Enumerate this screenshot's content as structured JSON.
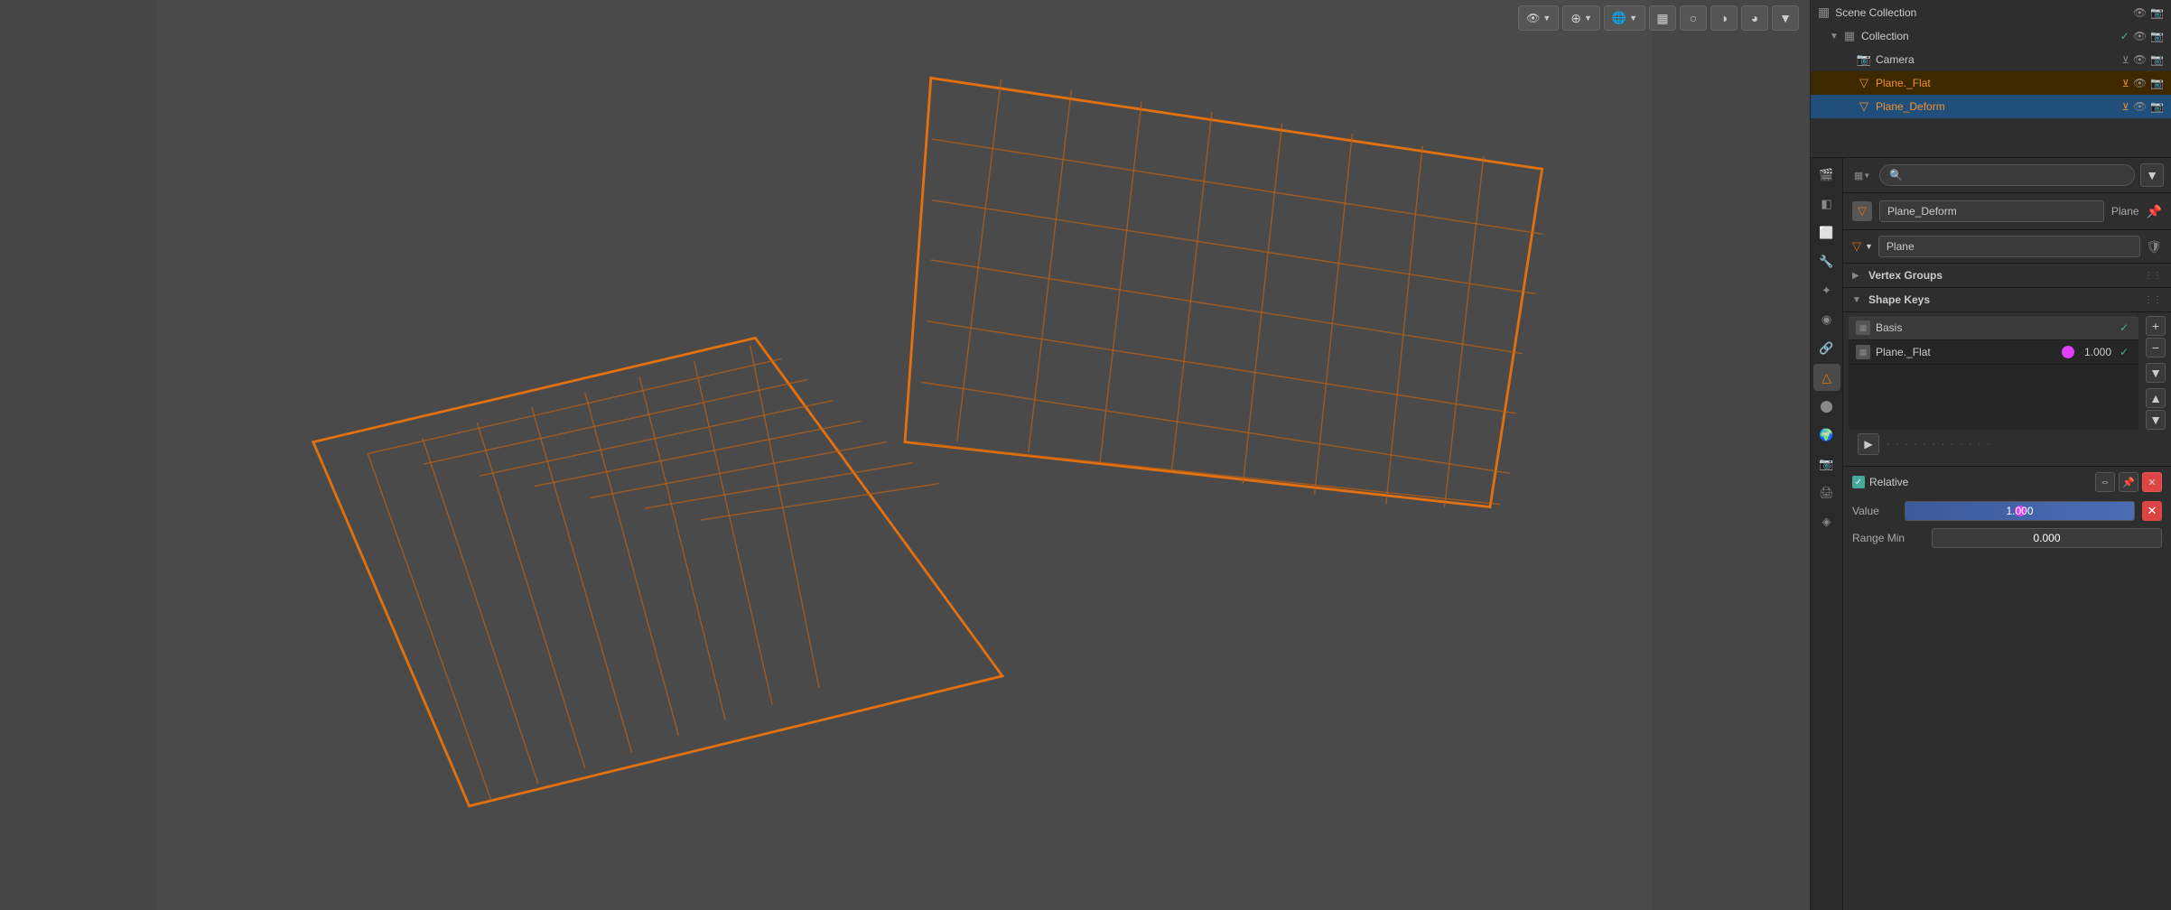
{
  "viewport": {
    "background_color": "#464646"
  },
  "toolbar": {
    "buttons": [
      {
        "id": "viewport-shading-icon",
        "label": "👁",
        "dropdown": true
      },
      {
        "id": "overlay-icon",
        "label": "⊕",
        "dropdown": true
      },
      {
        "id": "gizmo-icon",
        "label": "🌐",
        "dropdown": true
      },
      {
        "id": "object-mode-icon",
        "label": "▦"
      },
      {
        "id": "sphere-icon",
        "label": "○"
      },
      {
        "id": "material-icon",
        "label": "◑"
      },
      {
        "id": "rendered-icon",
        "label": "◕"
      },
      {
        "id": "dropdown-icon",
        "label": "▼"
      }
    ]
  },
  "outliner": {
    "header_title": "Scene Collection",
    "scene_collection_label": "Scene Collection",
    "collection_label": "Collection",
    "items": [
      {
        "id": "camera",
        "label": "Camera",
        "icon": "📷",
        "indent": 2,
        "selected": false
      },
      {
        "id": "plane-flat",
        "label": "Plane._Flat",
        "icon": "▽",
        "indent": 2,
        "selected": true,
        "highlight": "orange"
      },
      {
        "id": "plane-deform",
        "label": "Plane_Deform",
        "icon": "▽",
        "indent": 2,
        "selected": true,
        "highlight": "blue"
      }
    ]
  },
  "properties": {
    "search_placeholder": "🔍",
    "object_name": "Plane_Deform",
    "object_icon": "▽",
    "object_type": "Plane",
    "mesh_name": "Plane",
    "sections": {
      "vertex_groups": {
        "label": "Vertex Groups",
        "collapsed": true
      },
      "shape_keys": {
        "label": "Shape Keys",
        "collapsed": false,
        "items": [
          {
            "id": "basis",
            "name": "Basis",
            "checked": true,
            "has_dot": false,
            "value": null
          },
          {
            "id": "plane-flat-key",
            "name": "Plane._Flat",
            "checked": true,
            "has_dot": true,
            "value": "1.000"
          }
        ]
      }
    },
    "relative": {
      "label": "Relative",
      "checked": true
    },
    "value_slider": {
      "label": "Value",
      "value": "1.000",
      "percent": 100
    },
    "range_min": {
      "label": "Range Min",
      "value": "0.000"
    }
  },
  "side_icons": [
    {
      "id": "scene-icon",
      "symbol": "🎬",
      "active": false
    },
    {
      "id": "view-layer-icon",
      "symbol": "◧",
      "active": false
    },
    {
      "id": "object-props-icon",
      "symbol": "⬜",
      "active": false
    },
    {
      "id": "modifier-icon",
      "symbol": "🔧",
      "active": false
    },
    {
      "id": "particles-icon",
      "symbol": "✦",
      "active": false
    },
    {
      "id": "physics-icon",
      "symbol": "◉",
      "active": false
    },
    {
      "id": "constraints-icon",
      "symbol": "🔗",
      "active": false
    },
    {
      "id": "object-data-icon",
      "symbol": "△",
      "active": true
    },
    {
      "id": "material-icon",
      "symbol": "⬤",
      "active": false
    },
    {
      "id": "world-icon",
      "symbol": "🌍",
      "active": false
    },
    {
      "id": "render-icon",
      "symbol": "📷",
      "active": false
    },
    {
      "id": "output-icon",
      "symbol": "🖨",
      "active": false
    },
    {
      "id": "compositing-icon",
      "symbol": "◈",
      "active": false
    }
  ]
}
